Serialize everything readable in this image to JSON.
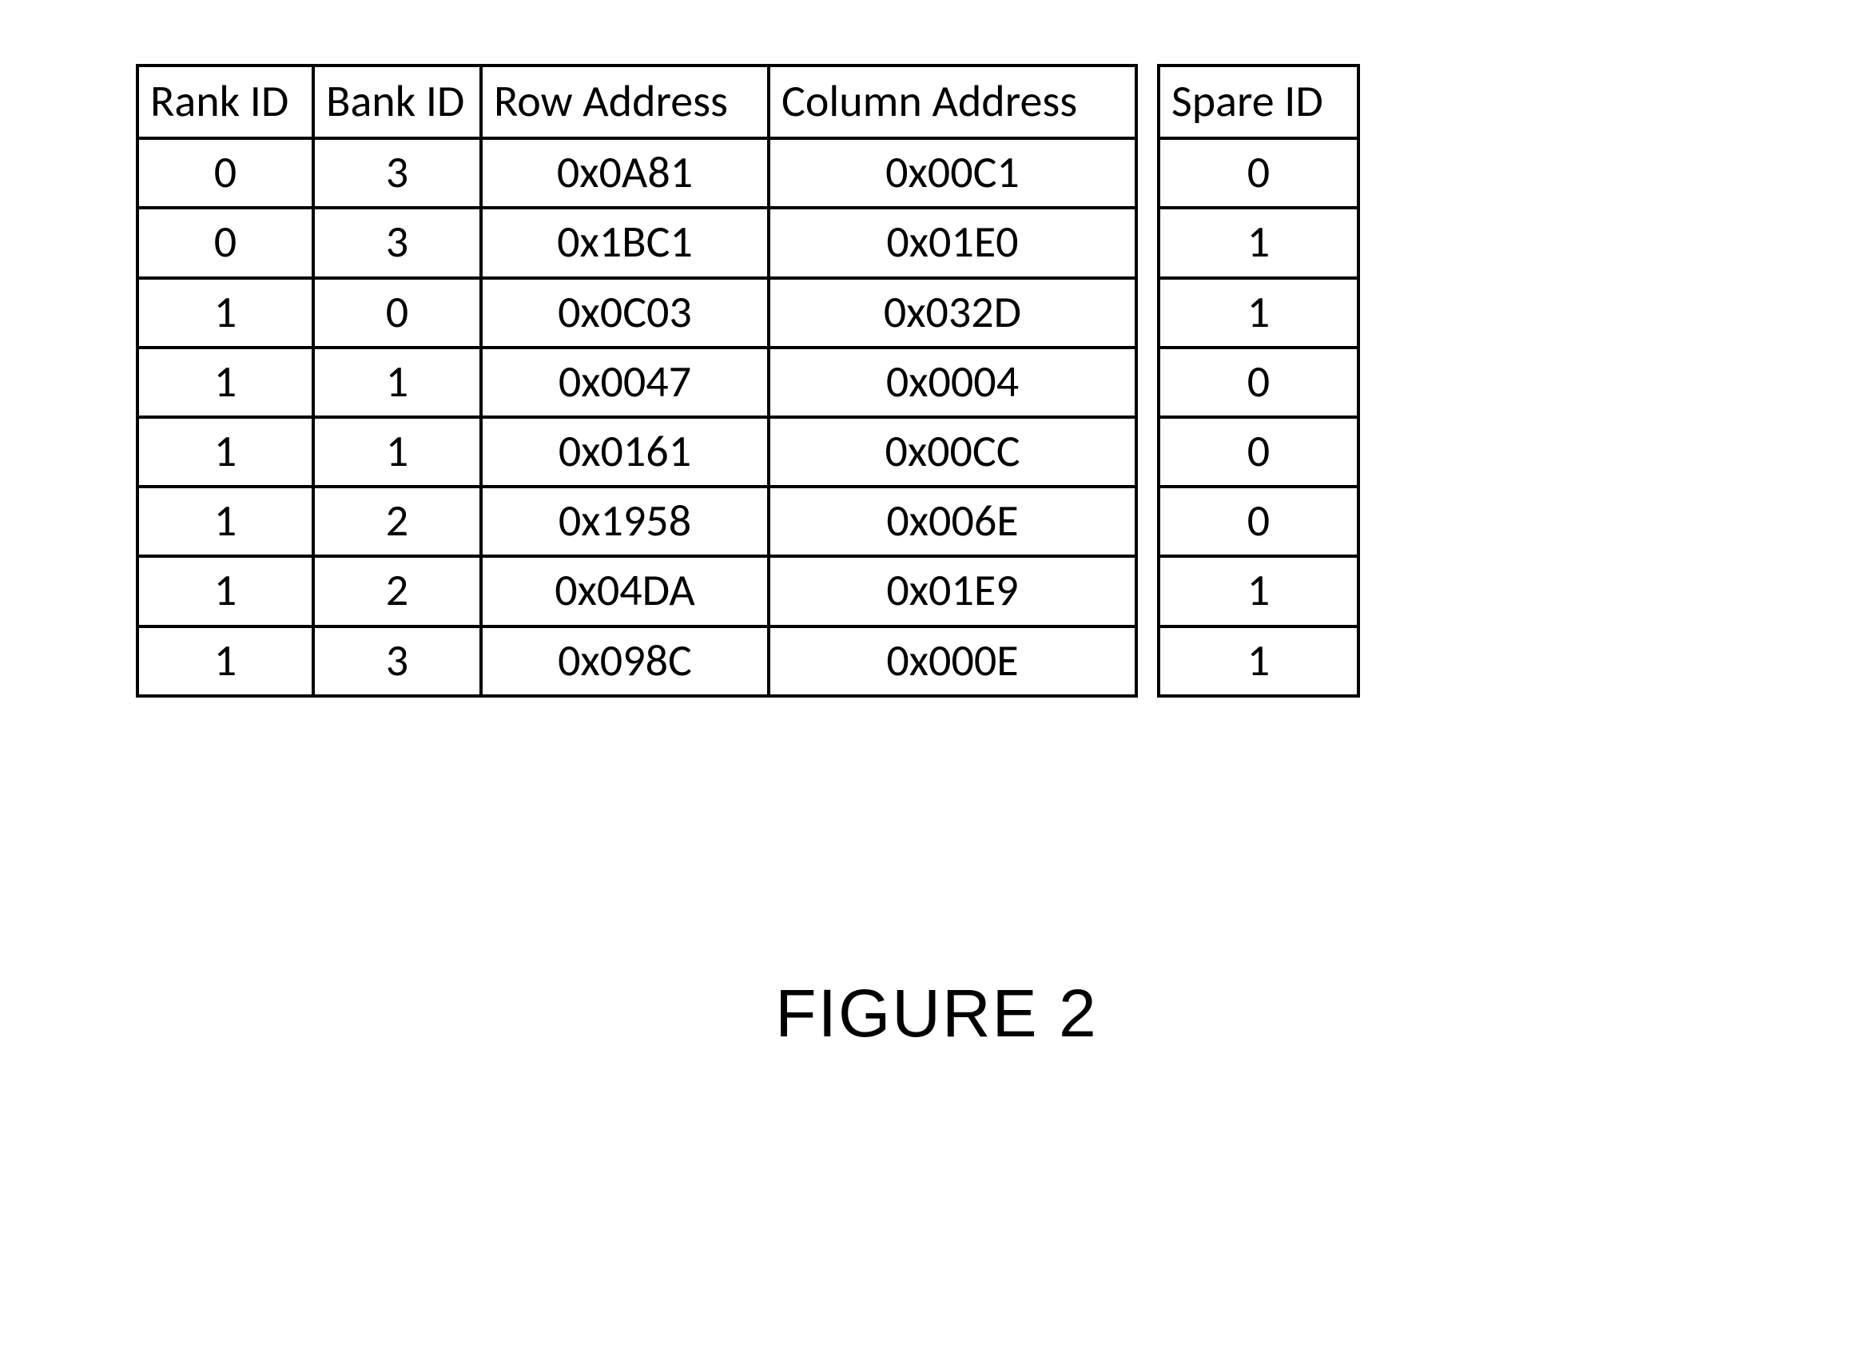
{
  "headers": {
    "rank_id": "Rank ID",
    "bank_id": "Bank ID",
    "row_address": "Row Address",
    "column_address": "Column Address",
    "spare_id": "Spare ID"
  },
  "rows": [
    {
      "rank_id": "0",
      "bank_id": "3",
      "row_address": "0x0A81",
      "column_address": "0x00C1",
      "spare_id": "0"
    },
    {
      "rank_id": "0",
      "bank_id": "3",
      "row_address": "0x1BC1",
      "column_address": "0x01E0",
      "spare_id": "1"
    },
    {
      "rank_id": "1",
      "bank_id": "0",
      "row_address": "0x0C03",
      "column_address": "0x032D",
      "spare_id": "1"
    },
    {
      "rank_id": "1",
      "bank_id": "1",
      "row_address": "0x0047",
      "column_address": "0x0004",
      "spare_id": "0"
    },
    {
      "rank_id": "1",
      "bank_id": "1",
      "row_address": "0x0161",
      "column_address": "0x00CC",
      "spare_id": "0"
    },
    {
      "rank_id": "1",
      "bank_id": "2",
      "row_address": "0x1958",
      "column_address": "0x006E",
      "spare_id": "0"
    },
    {
      "rank_id": "1",
      "bank_id": "2",
      "row_address": "0x04DA",
      "column_address": "0x01E9",
      "spare_id": "1"
    },
    {
      "rank_id": "1",
      "bank_id": "3",
      "row_address": "0x098C",
      "column_address": "0x000E",
      "spare_id": "1"
    }
  ],
  "caption": "FIGURE 2"
}
